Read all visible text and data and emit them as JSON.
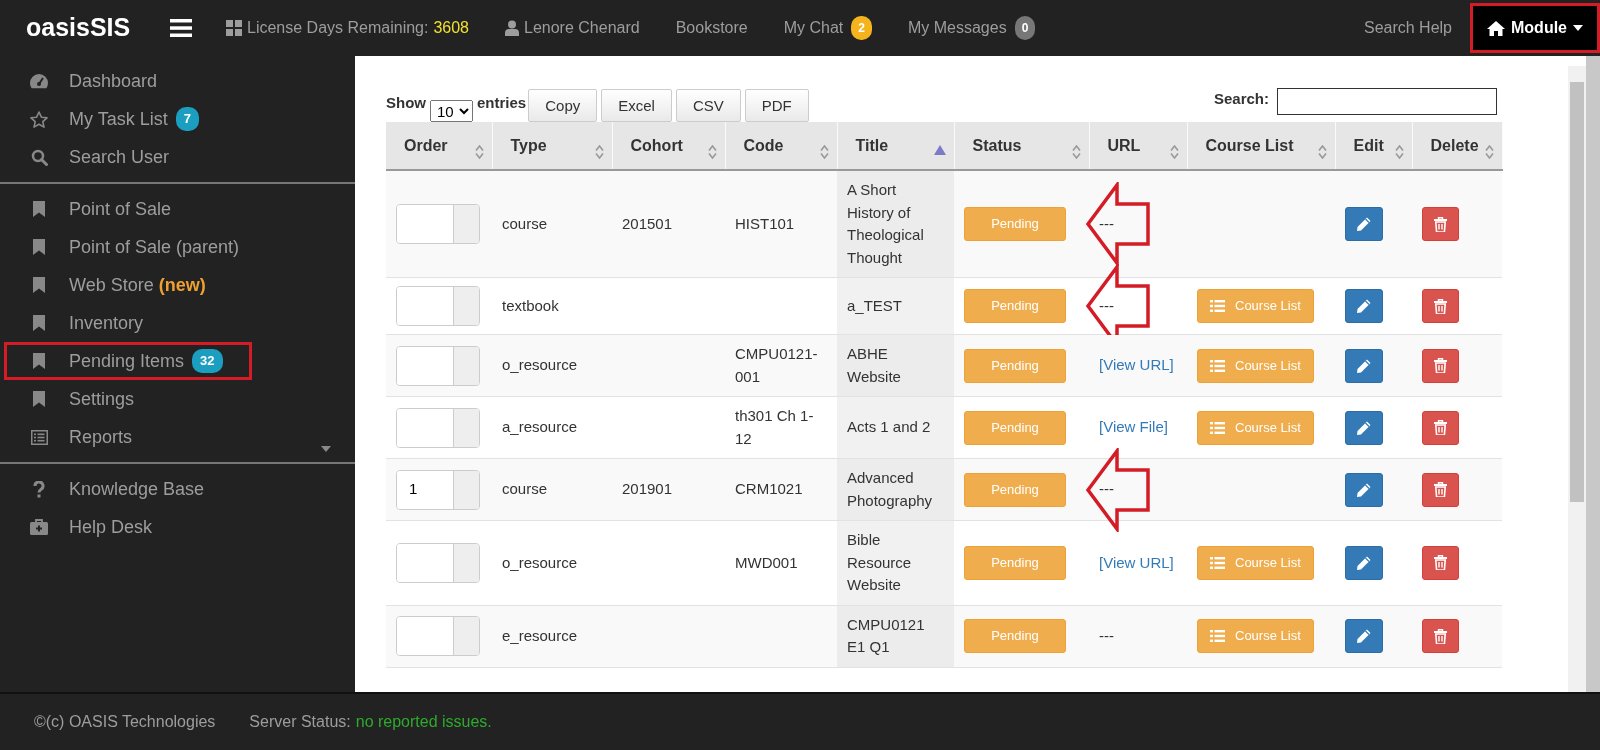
{
  "brand": "oasisSIS",
  "navbar": {
    "items": [
      {
        "kind": "license",
        "label": "License Days Remaining:",
        "value": "3608"
      },
      {
        "kind": "user",
        "label": "Lenore Chenard"
      },
      {
        "kind": "link",
        "label": "Bookstore"
      },
      {
        "kind": "counter",
        "label": "My Chat",
        "badge": "2",
        "color": "#f5b41e"
      },
      {
        "kind": "counter",
        "label": "My Messages",
        "badge": "0",
        "color": "#777777"
      }
    ],
    "search_help": "Search Help",
    "module": {
      "label": "Module",
      "annotated": true
    }
  },
  "sidebar": {
    "groups": [
      {
        "items": [
          {
            "label": "Dashboard",
            "annotated": false,
            "submenu": false
          },
          {
            "label": "My Task List",
            "badge": "7",
            "annotated": false,
            "submenu": false
          },
          {
            "label": "Search User",
            "annotated": false,
            "submenu": false
          }
        ]
      },
      {
        "items": [
          {
            "label": "Point of Sale",
            "annotated": false,
            "submenu": false
          },
          {
            "label": "Point of Sale (parent)",
            "annotated": false,
            "submenu": false
          },
          {
            "label": "Web Store",
            "tag": "(new)",
            "annotated": false,
            "submenu": false
          },
          {
            "label": "Inventory",
            "annotated": false,
            "submenu": false
          },
          {
            "label": "Pending Items",
            "badge": "32",
            "annotated": true,
            "submenu": false
          },
          {
            "label": "Settings",
            "annotated": false,
            "submenu": false
          },
          {
            "label": "Reports",
            "annotated": false,
            "submenu": true
          }
        ]
      },
      {
        "items": [
          {
            "label": "Knowledge Base",
            "annotated": false,
            "submenu": false
          },
          {
            "label": "Help Desk",
            "annotated": false,
            "submenu": false
          }
        ]
      }
    ]
  },
  "table_controls": {
    "show_label": "Show",
    "length": "10",
    "entries_label": "entries",
    "buttons": [
      "Copy",
      "Excel",
      "CSV",
      "PDF"
    ],
    "search_label": "Search:"
  },
  "table": {
    "columns": [
      {
        "label": "Order",
        "sorted": false
      },
      {
        "label": "Type",
        "sorted": false
      },
      {
        "label": "Cohort",
        "sorted": false
      },
      {
        "label": "Code",
        "sorted": false
      },
      {
        "label": "Title",
        "sorted": true
      },
      {
        "label": "Status",
        "sorted": false
      },
      {
        "label": "URL",
        "sorted": false
      },
      {
        "label": "Course List",
        "sorted": false
      },
      {
        "label": "Edit",
        "sorted": false
      },
      {
        "label": "Delete",
        "sorted": false
      }
    ],
    "rows": [
      {
        "type": "course",
        "cohort": "201501",
        "code": "HIST101",
        "title": "A Short History of Theological Thought",
        "status": "Pending",
        "url": "---",
        "url_link": false,
        "arrow": true
      },
      {
        "type": "textbook",
        "title": "a_TEST",
        "status": "Pending",
        "url": "---",
        "url_link": false,
        "course_list": "Course List",
        "arrow": true
      },
      {
        "type": "o_resource",
        "code": "CMPU0121-001",
        "title": "ABHE Website",
        "status": "Pending",
        "url": "[View URL]",
        "url_link": true,
        "course_list": "Course List",
        "arrow": false
      },
      {
        "type": "a_resource",
        "code": "th301 Ch 1-12",
        "title": "Acts 1 and 2",
        "status": "Pending",
        "url": "[View File]",
        "url_link": true,
        "course_list": "Course List",
        "arrow": false
      },
      {
        "order": "1",
        "type": "course",
        "cohort": "201901",
        "code": "CRM1021",
        "title": "Advanced Photography",
        "status": "Pending",
        "url": "---",
        "url_link": false,
        "arrow": true
      },
      {
        "type": "o_resource",
        "code": "MWD001",
        "title": "Bible Resource Website",
        "status": "Pending",
        "url": "[View URL]",
        "url_link": true,
        "course_list": "Course List",
        "arrow": false
      },
      {
        "type": "e_resource",
        "title": "CMPU0121 E1 Q1",
        "status": "Pending",
        "url": "---",
        "url_link": false,
        "course_list": "Course List",
        "arrow": false
      }
    ]
  },
  "footer": {
    "copyright": "©(c) OASIS Technologies",
    "status_label": "Server Status:",
    "status_value": "no reported issues."
  }
}
